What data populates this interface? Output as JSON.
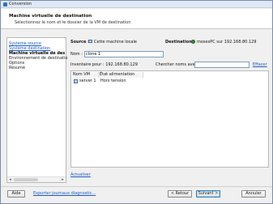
{
  "window": {
    "title": "Conversion"
  },
  "header": {
    "title": "Machine virtuelle de destination",
    "subtitle": "Sélectionnez le nom et le dossier de la VM de destination"
  },
  "nav": {
    "items": [
      {
        "label": "Système source",
        "state": "link"
      },
      {
        "label": "Système destination",
        "state": "link"
      },
      {
        "label": "Machine virtuelle de des",
        "state": "active"
      },
      {
        "label": "Environnement de destinatio",
        "state": "plain"
      },
      {
        "label": "Options",
        "state": "plain"
      },
      {
        "label": "Résumé",
        "state": "plain"
      }
    ]
  },
  "main": {
    "source_label": "Source :",
    "source_value": "Cette machine locale",
    "destination_label": "Destination :",
    "destination_value": "mosesPC sur 192.168.80.129",
    "name_label": "Nom :",
    "name_value": "clone 1",
    "inventory_label": "Inventaire pour : 192.168.80.129",
    "search_label": "Chercher noms avec :",
    "search_value": "",
    "clear_link": "Effacer",
    "columns": [
      "Nom VM",
      "État alimentation"
    ],
    "rows": [
      {
        "name": "server 1",
        "state": "Hors tension"
      }
    ],
    "refresh_link": "Actualiser"
  },
  "footer": {
    "help": "Aide",
    "export": "Exporter journaux diagnostic...",
    "back": "< Retour",
    "next": "Suivant >",
    "cancel": "Annuler"
  }
}
